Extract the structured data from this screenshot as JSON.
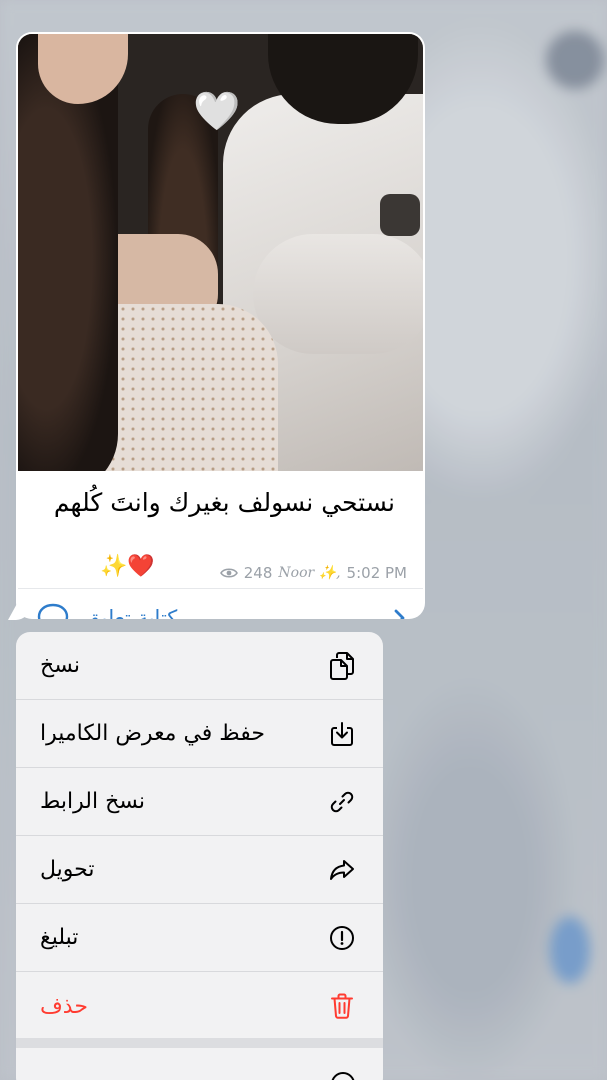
{
  "message": {
    "caption": "نستحي نسولف بغيرك وانتَ كُلهم",
    "caption_emoji": "✨❤️",
    "views": "248",
    "author": "Noor ✨,",
    "time": "5:02 PM",
    "comment_label": "كتابة تعليق",
    "photo_emoji": "🤍"
  },
  "context_menu": {
    "items": [
      {
        "label": "نسخ",
        "icon": "copy-icon"
      },
      {
        "label": "حفظ في معرض الكاميرا",
        "icon": "save-to-gallery-icon"
      },
      {
        "label": "نسخ الرابط",
        "icon": "link-icon"
      },
      {
        "label": "تحويل",
        "icon": "forward-icon"
      },
      {
        "label": "تبليغ",
        "icon": "report-icon"
      },
      {
        "label": "حذف",
        "icon": "trash-icon",
        "destructive": true
      }
    ]
  },
  "colors": {
    "accent": "#2e7ccb",
    "destructive": "#ff3b30",
    "meta": "#9ba1a8",
    "menu_bg": "#f2f2f3"
  }
}
